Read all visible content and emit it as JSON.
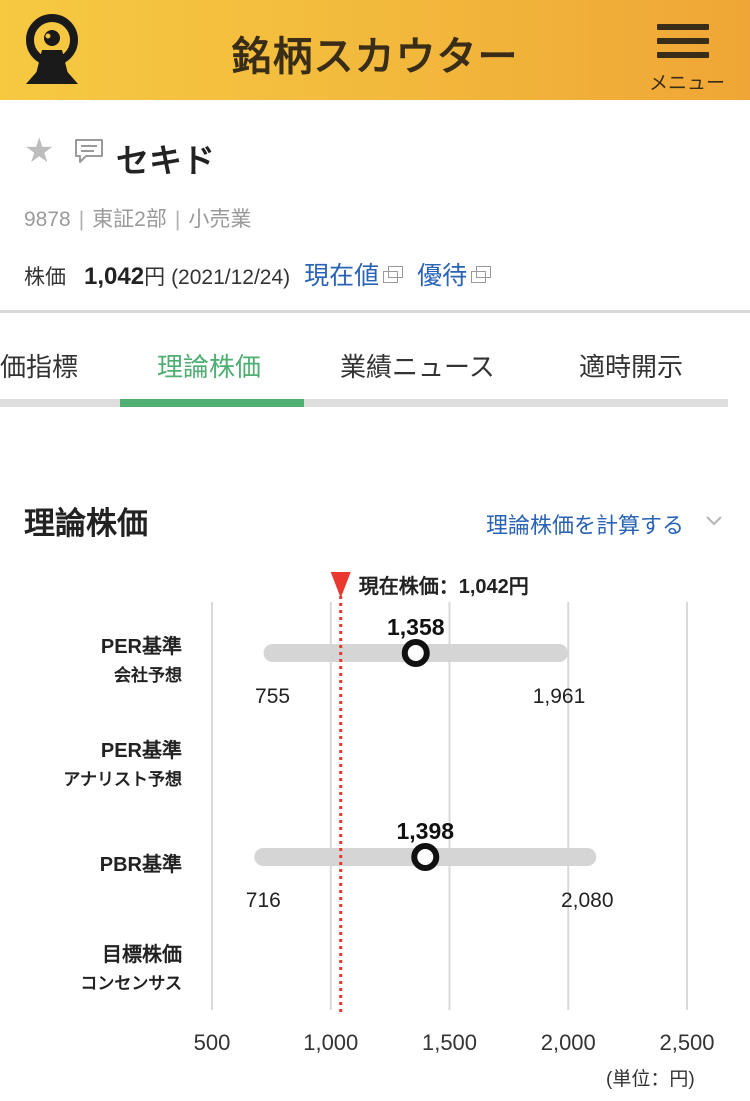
{
  "header": {
    "app_title": "銘柄スカウター",
    "menu_label": "メニュー",
    "brand_color": "#f2b83c"
  },
  "stock": {
    "name": "セキド",
    "code": "9878",
    "market": "東証2部",
    "sector": "小売業",
    "price_label": "株価",
    "price_value": "1,042",
    "price_unit": "円",
    "price_date": "(2021/12/24)",
    "link_current": "現在値",
    "link_benefits": "優待"
  },
  "tabs": [
    {
      "label": "価指標",
      "active": false
    },
    {
      "label": "理論株価",
      "active": true
    },
    {
      "label": "業績ニュース",
      "active": false
    },
    {
      "label": "適時開示",
      "active": false
    }
  ],
  "section": {
    "title": "理論株価",
    "calc_link": "理論株価を計算する"
  },
  "chart_data": {
    "type": "range",
    "current_price_label": "現在株価：1,042円",
    "current_price": 1042,
    "x_ticks": [
      "500",
      "1,000",
      "1,500",
      "2,000",
      "2,500"
    ],
    "xlim": [
      500,
      2500
    ],
    "unit_note": "(単位：円)",
    "rows": [
      {
        "label1": "PER基準",
        "label2": "会社予想",
        "low": 755,
        "high": 1961,
        "value": 1358,
        "low_label": "755",
        "high_label": "1,961",
        "value_label": "1,358"
      },
      {
        "label1": "PER基準",
        "label2": "アナリスト予想",
        "low": null,
        "high": null,
        "value": null,
        "low_label": "",
        "high_label": "",
        "value_label": ""
      },
      {
        "label1": "PBR基準",
        "label2": "",
        "low": 716,
        "high": 2080,
        "value": 1398,
        "low_label": "716",
        "high_label": "2,080",
        "value_label": "1,398"
      },
      {
        "label1": "目標株価",
        "label2": "コンセンサス",
        "low": null,
        "high": null,
        "value": null,
        "low_label": "",
        "high_label": "",
        "value_label": ""
      }
    ],
    "colors": {
      "marker": "#e8382f",
      "range_bar": "#d5d5d5",
      "grid": "#d9d9d9",
      "point": "#111111"
    }
  }
}
